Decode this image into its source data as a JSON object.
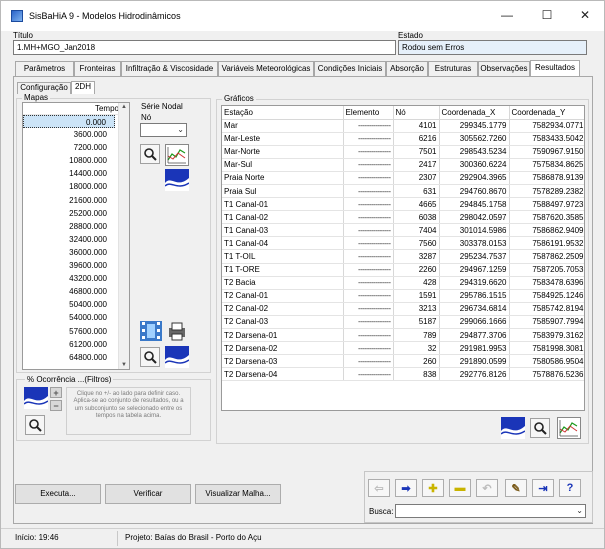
{
  "window": {
    "title": "SisBaHiA 9 - Modelos Hidrodinâmicos",
    "controls": {
      "minimize": "—",
      "maximize": "☐",
      "close": "✕"
    }
  },
  "titulo": {
    "label": "Título",
    "value": "1.MH+MGO_Jan2018"
  },
  "estado": {
    "label": "Estado",
    "value": "Rodou sem Erros"
  },
  "tabs": [
    {
      "label": "Parâmetros"
    },
    {
      "label": "Fronteiras"
    },
    {
      "label": "Infiltração & Viscosidade"
    },
    {
      "label": "Variáveis Meteorológicas"
    },
    {
      "label": "Condições Iniciais"
    },
    {
      "label": "Absorção"
    },
    {
      "label": "Estruturas"
    },
    {
      "label": "Observações"
    },
    {
      "label": "Resultados"
    }
  ],
  "subtabs": [
    {
      "label": "Configuração"
    },
    {
      "label": "2DH"
    }
  ],
  "mapas": {
    "group_label": "Mapas",
    "column_header": "Tempo",
    "values": [
      "0.000",
      "3600.000",
      "7200.000",
      "10800.000",
      "14400.000",
      "18000.000",
      "21600.000",
      "25200.000",
      "28800.000",
      "32400.000",
      "36000.000",
      "39600.000",
      "43200.000",
      "46800.000",
      "50400.000",
      "54000.000",
      "57600.000",
      "61200.000",
      "64800.000"
    ]
  },
  "serie_nodal": {
    "label": "Série Nodal",
    "no_label": "Nó",
    "value": ""
  },
  "ocorrencia": {
    "label": "% Ocorrência ...(Filtros)",
    "hint": "Clique no +/- ao lado para definir caso. Aplica-se ao conjunto de resultados, ou a um subconjunto se selecionado entre os tempos na tabela acima."
  },
  "graficos": {
    "group_label": "Gráficos",
    "columns": [
      "Estação",
      "Elemento",
      "Nó",
      "Coordenada_X",
      "Coordenada_Y"
    ],
    "rows": [
      [
        "Mar",
        "---------------",
        "4101",
        "299345.1779",
        "7582934.0771"
      ],
      [
        "Mar-Leste",
        "---------------",
        "6216",
        "305562.7260",
        "7583433.5042"
      ],
      [
        "Mar-Norte",
        "---------------",
        "7501",
        "298543.5234",
        "7590967.9150"
      ],
      [
        "Mar-Sul",
        "---------------",
        "2417",
        "300360.6224",
        "7575834.8625"
      ],
      [
        "Praia Norte",
        "---------------",
        "2307",
        "292904.3965",
        "7586878.9139"
      ],
      [
        "Praia Sul",
        "---------------",
        "631",
        "294760.8670",
        "7578289.2382"
      ],
      [
        "T1 Canal-01",
        "---------------",
        "4665",
        "294845.1758",
        "7588497.9723"
      ],
      [
        "T1 Canal-02",
        "---------------",
        "6038",
        "298042.0597",
        "7587620.3585"
      ],
      [
        "T1 Canal-03",
        "---------------",
        "7404",
        "301014.5986",
        "7586862.9409"
      ],
      [
        "T1 Canal-04",
        "---------------",
        "7560",
        "303378.0153",
        "7586191.9532"
      ],
      [
        "T1 T-OIL",
        "---------------",
        "3287",
        "295234.7537",
        "7587862.2509"
      ],
      [
        "T1 T-ORE",
        "---------------",
        "2260",
        "294967.1259",
        "7587205.7053"
      ],
      [
        "T2 Bacia",
        "---------------",
        "428",
        "294319.6620",
        "7583478.6396"
      ],
      [
        "T2 Canal-01",
        "---------------",
        "1591",
        "295786.1515",
        "7584925.1246"
      ],
      [
        "T2 Canal-02",
        "---------------",
        "3213",
        "296734.6814",
        "7585742.8194"
      ],
      [
        "T2 Canal-03",
        "---------------",
        "5187",
        "299066.1666",
        "7585907.7994"
      ],
      [
        "T2 Darsena-01",
        "---------------",
        "789",
        "294877.3706",
        "7583979.3162"
      ],
      [
        "T2 Darsena-02",
        "---------------",
        "32",
        "291981.9953",
        "7581998.3081"
      ],
      [
        "T2 Darsena-03",
        "---------------",
        "260",
        "291890.0599",
        "7580586.9504"
      ],
      [
        "T2 Darsena-04",
        "---------------",
        "838",
        "292776.8126",
        "7578876.5236"
      ]
    ]
  },
  "buttons": {
    "executa": "Executa...",
    "verificar": "Verificar",
    "visualizar_malha": "Visualizar Malha..."
  },
  "busca": {
    "label": "Busca:",
    "value": ""
  },
  "status": {
    "inicio": "Início: 19:46",
    "projeto": "Projeto: Baías do Brasil - Porto do Açu"
  },
  "colors": {
    "selection": "#cce4f7",
    "accent_blue": "#1a35b8",
    "accent_yellow": "#f3d21a",
    "accent_green": "#2f9a2f"
  }
}
